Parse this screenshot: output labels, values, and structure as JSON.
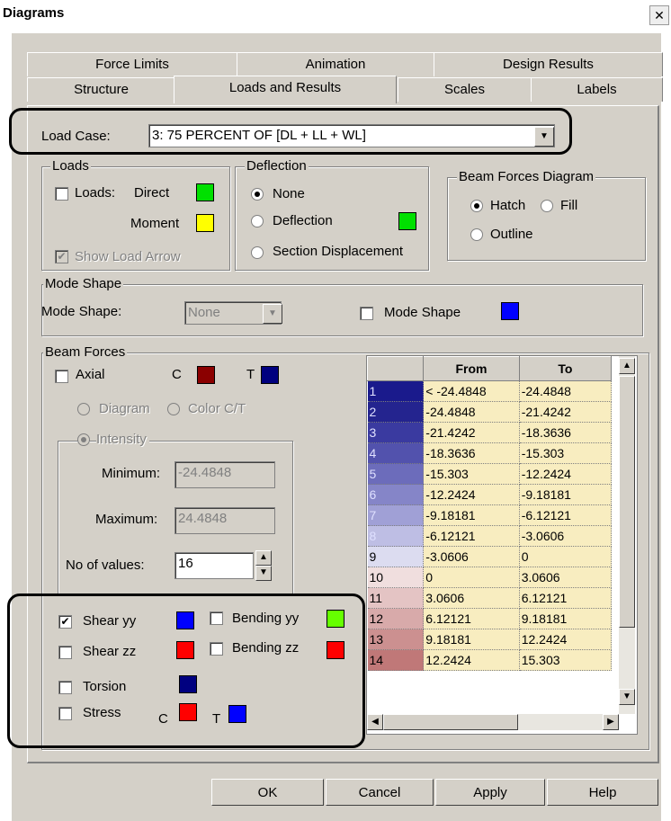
{
  "window": {
    "title": "Diagrams",
    "close_glyph": "✕"
  },
  "tabs": {
    "row1": [
      "Force Limits",
      "Animation",
      "Design Results"
    ],
    "row2": [
      "Structure",
      "Loads and Results",
      "Scales",
      "Labels"
    ]
  },
  "load_case": {
    "label": "Load Case:",
    "value": "3: 75 PERCENT OF [DL + LL + WL]"
  },
  "loads": {
    "group": "Loads",
    "loads_label": "Loads:",
    "direct": "Direct",
    "moment": "Moment",
    "show_arrow": "Show Load Arrow",
    "direct_color": "#00e000",
    "moment_color": "#ffff00"
  },
  "deflection": {
    "group": "Deflection",
    "none": "None",
    "deflection": "Deflection",
    "section": "Section Displacement",
    "color": "#00e000"
  },
  "beam_diagram": {
    "group": "Beam Forces Diagram",
    "hatch": "Hatch",
    "fill": "Fill",
    "outline": "Outline"
  },
  "mode_shape": {
    "group": "Mode Shape",
    "label": "Mode Shape:",
    "value": "None",
    "checkbox": "Mode Shape",
    "color": "#0000ff"
  },
  "beam_forces": {
    "group": "Beam Forces",
    "axial": "Axial",
    "c": "C",
    "t": "T",
    "c_color": "#8b0000",
    "t_color": "#00007f",
    "diagram": "Diagram",
    "color_ct": "Color C/T",
    "intensity": "Intensity",
    "minimum_label": "Minimum:",
    "minimum": "-24.4848",
    "maximum_label": "Maximum:",
    "maximum": "24.4848",
    "nvalues_label": "No of values:",
    "nvalues": "16",
    "shear_yy": "Shear yy",
    "shear_zz": "Shear zz",
    "bending_yy": "Bending yy",
    "bending_zz": "Bending zz",
    "torsion": "Torsion",
    "stress": "Stress",
    "shear_yy_color": "#0000ff",
    "shear_zz_color": "#ff0000",
    "bending_yy_color": "#66ff00",
    "bending_zz_color": "#ff0000",
    "torsion_color": "#000080",
    "stress_c_color": "#ff0000",
    "stress_t_color": "#0000ff"
  },
  "table": {
    "headers": [
      "",
      "From",
      "To"
    ],
    "rows": [
      {
        "idx": "1",
        "from": "< -24.4848",
        "to": "-24.4848",
        "color": "#1a1a8c"
      },
      {
        "idx": "2",
        "from": "-24.4848",
        "to": "-21.4242",
        "color": "#24248f"
      },
      {
        "idx": "3",
        "from": "-21.4242",
        "to": "-18.3636",
        "color": "#3a3aa0"
      },
      {
        "idx": "4",
        "from": "-18.3636",
        "to": "-15.303",
        "color": "#5252ad"
      },
      {
        "idx": "5",
        "from": "-15.303",
        "to": "-12.2424",
        "color": "#6c6cbb"
      },
      {
        "idx": "6",
        "from": "-12.2424",
        "to": "-9.18181",
        "color": "#8585c8"
      },
      {
        "idx": "7",
        "from": "-9.18181",
        "to": "-6.12121",
        "color": "#a0a0d6"
      },
      {
        "idx": "8",
        "from": "-6.12121",
        "to": "-3.0606",
        "color": "#bebee4"
      },
      {
        "idx": "9",
        "from": "-3.0606",
        "to": "0",
        "color": "#dcdcf0"
      },
      {
        "idx": "10",
        "from": "0",
        "to": "3.0606",
        "color": "#f0dede"
      },
      {
        "idx": "11",
        "from": "3.0606",
        "to": "6.12121",
        "color": "#e4c4c4"
      },
      {
        "idx": "12",
        "from": "6.12121",
        "to": "9.18181",
        "color": "#d8aaaa"
      },
      {
        "idx": "13",
        "from": "9.18181",
        "to": "12.2424",
        "color": "#cc9090"
      },
      {
        "idx": "14",
        "from": "12.2424",
        "to": "15.303",
        "color": "#c07878"
      }
    ]
  },
  "buttons": {
    "ok": "OK",
    "cancel": "Cancel",
    "apply": "Apply",
    "help": "Help"
  }
}
